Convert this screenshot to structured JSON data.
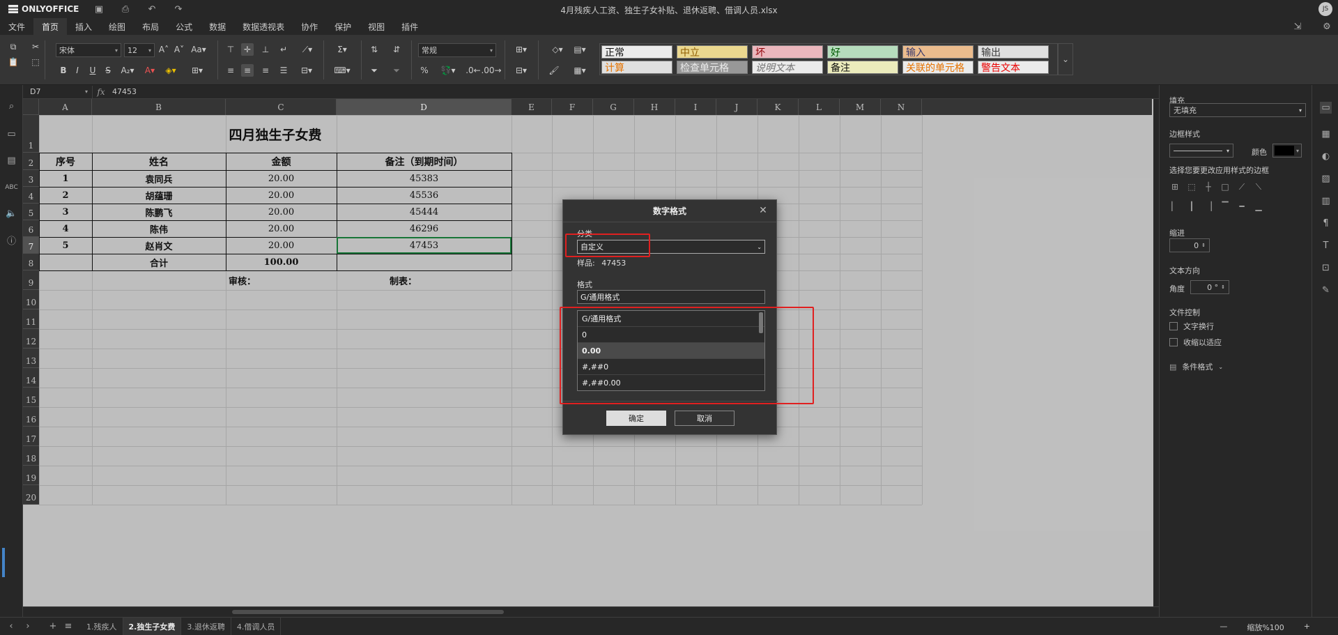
{
  "titlebar": {
    "app_name": "ONLYOFFICE",
    "doc_title": "4月残疾人工资、独生子女补贴、退休返聘、借调人员.xlsx",
    "avatar": "JS"
  },
  "menu": {
    "tabs": [
      "文件",
      "首页",
      "插入",
      "绘图",
      "布局",
      "公式",
      "数据",
      "数据透视表",
      "协作",
      "保护",
      "视图",
      "插件"
    ],
    "active_index": 1
  },
  "toolbar": {
    "font_name": "宋体",
    "font_size": "12",
    "number_format": "常规"
  },
  "styles": [
    {
      "label": "正常",
      "bg": "#ffffff",
      "color": "#111111"
    },
    {
      "label": "中立",
      "bg": "#ffeb9c",
      "color": "#9c6500"
    },
    {
      "label": "坏",
      "bg": "#ffc7ce",
      "color": "#9c0006"
    },
    {
      "label": "好",
      "bg": "#c6efce",
      "color": "#006100"
    },
    {
      "label": "输入",
      "bg": "#ffcc99",
      "color": "#3f3f76"
    },
    {
      "label": "输出",
      "bg": "#f2f2f2",
      "color": "#3f3f3f"
    },
    {
      "label": "计算",
      "bg": "#f2f2f2",
      "color": "#fa7d00"
    },
    {
      "label": "检查单元格",
      "bg": "#a5a5a5",
      "color": "#ffffff"
    },
    {
      "label": "说明文本",
      "bg": "#ffffff",
      "color": "#7f7f7f"
    },
    {
      "label": "备注",
      "bg": "#ffffcc",
      "color": "#111111"
    },
    {
      "label": "关联的单元格",
      "bg": "#ffffff",
      "color": "#fa7d00"
    },
    {
      "label": "警告文本",
      "bg": "#ffffff",
      "color": "#ff0000"
    }
  ],
  "formula_bar": {
    "name_box": "D7",
    "fx": "fx",
    "value": "47453"
  },
  "columns": [
    "A",
    "B",
    "C",
    "D",
    "E",
    "F",
    "G",
    "H",
    "I",
    "J",
    "K",
    "L",
    "M",
    "N"
  ],
  "rows": [
    "1",
    "2",
    "3",
    "4",
    "5",
    "6",
    "7",
    "8",
    "9",
    "10",
    "11",
    "12",
    "13",
    "14",
    "15",
    "16",
    "17",
    "18",
    "19",
    "20"
  ],
  "sheet": {
    "title": "四月独生子女费",
    "headers": [
      "序号",
      "姓名",
      "金额",
      "备注（到期时间）"
    ],
    "data": [
      [
        "1",
        "袁同兵",
        "20.00",
        "45383"
      ],
      [
        "2",
        "胡蕴珊",
        "20.00",
        "45536"
      ],
      [
        "3",
        "陈鹏飞",
        "20.00",
        "45444"
      ],
      [
        "4",
        "陈伟",
        "20.00",
        "46296"
      ],
      [
        "5",
        "赵肖文",
        "20.00",
        "47453"
      ]
    ],
    "total_label": "合计",
    "total_value": "100.00",
    "reviewer": "审核：",
    "preparer": "制表："
  },
  "right_panel": {
    "fill_label": "填充",
    "fill_value": "无填充",
    "border_style_label": "边框样式",
    "color_label": "颜色",
    "border_hint": "选择您要更改应用样式的边框",
    "indent_label": "缩进",
    "indent_value": "0",
    "text_direction_label": "文本方向",
    "angle_label": "角度",
    "angle_value": "0 °",
    "text_control_label": "文件控制",
    "wrap_label": "文字换行",
    "shrink_label": "收缩以适应",
    "cond_format_label": "条件格式"
  },
  "sheet_tabs": [
    "1.残疾人",
    "2.独生子女费",
    "3.退休返聘",
    "4.借调人员"
  ],
  "active_sheet": 1,
  "zoom": "缩放%100",
  "dialog": {
    "title": "数字格式",
    "category_label": "分类",
    "category_value": "自定义",
    "sample_label": "样品:",
    "sample_value": "47453",
    "format_label": "格式",
    "format_value": "G/通用格式",
    "format_list": [
      "G/通用格式",
      "0",
      "0.00",
      "#,##0",
      "#,##0.00"
    ],
    "selected_index": 2,
    "ok_label": "确定",
    "cancel_label": "取消"
  }
}
